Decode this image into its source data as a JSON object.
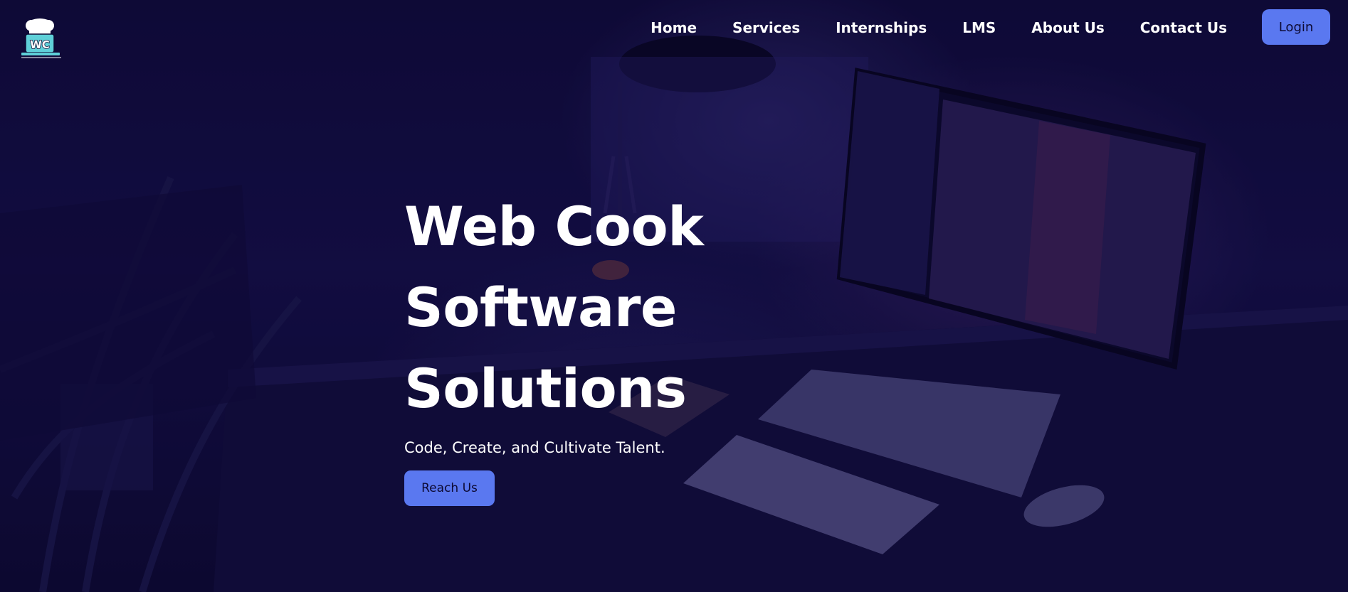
{
  "brand": {
    "logo_text": "WC"
  },
  "nav": {
    "links": [
      {
        "label": "Home"
      },
      {
        "label": "Services"
      },
      {
        "label": "Internships"
      },
      {
        "label": "LMS"
      },
      {
        "label": "About Us"
      },
      {
        "label": "Contact Us"
      }
    ],
    "login_label": "Login"
  },
  "hero": {
    "title_line1": "Web Cook Software",
    "title_line2": "Solutions",
    "subtitle": "Code, Create, and Cultivate Talent.",
    "cta_label": "Reach Us"
  },
  "colors": {
    "background": "#0d0a33",
    "accent": "#5a78f0",
    "text": "#ffffff"
  },
  "icons": {
    "logo": "chef-hat-laptop-logo"
  }
}
